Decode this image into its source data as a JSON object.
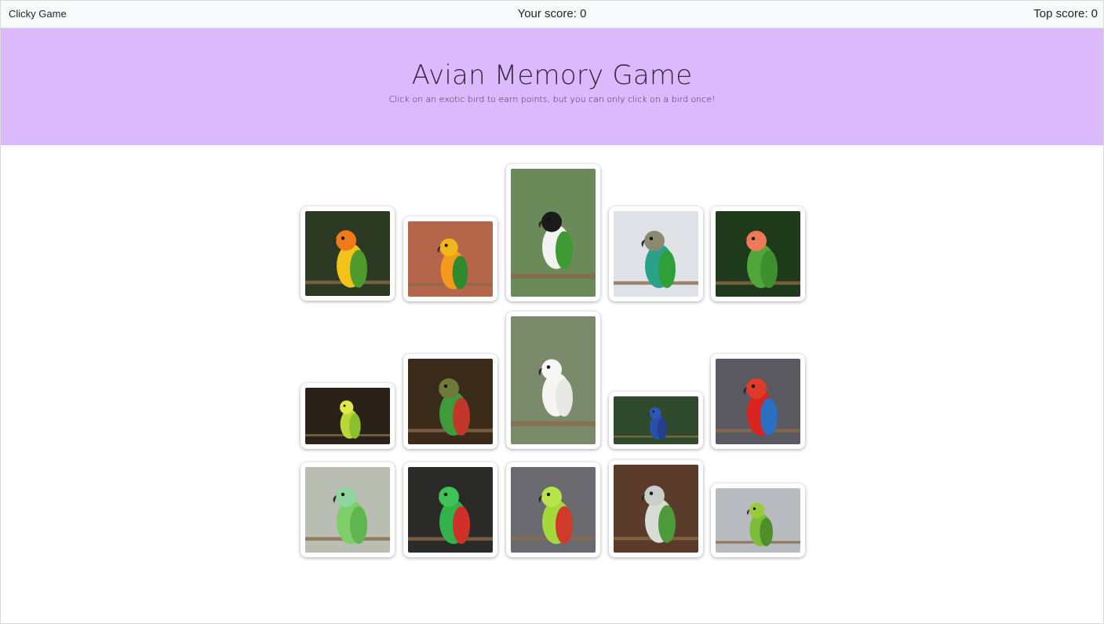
{
  "navbar": {
    "brand": "Clicky Game",
    "score_text": "Your score: 0",
    "top_score_text": "Top score: 0"
  },
  "header": {
    "title": "Avian Memory Game",
    "subtitle": "Click on an exotic bird to earn points, but you can only click on a bird once!"
  },
  "colors": {
    "header_background": "#dcb9fd",
    "navbar_background": "#f8f9fa"
  },
  "birds": [
    {
      "name": "sun-conure",
      "bg": "#2c3a24",
      "body": "#f2c21a",
      "head": "#f07a1a",
      "wing": "#4e9a2c"
    },
    {
      "name": "jenday-conure",
      "bg": "#b5654a",
      "body": "#f39a1d",
      "head": "#f2b51a",
      "wing": "#2f8a2e"
    },
    {
      "name": "black-headed-caique",
      "bg": "#6a8a5a",
      "body": "#f2f2f0",
      "head": "#1b1b1b",
      "wing": "#3f9a33"
    },
    {
      "name": "green-cheeked-conure",
      "bg": "#dfe3e8",
      "body": "#2aa28a",
      "head": "#8a8a70",
      "wing": "#2f9f3a"
    },
    {
      "name": "peach-faced-lovebird",
      "bg": "#1f3a1b",
      "body": "#4fa63a",
      "head": "#ef7a5a",
      "wing": "#3e8f2e"
    },
    {
      "name": "budgerigar",
      "bg": "#2a2118",
      "body": "#b8d83a",
      "head": "#e2ea4a",
      "wing": "#8bbf2e"
    },
    {
      "name": "crimson-bellied-conure",
      "bg": "#3a2a1a",
      "body": "#3f9a3a",
      "head": "#6d7a3a",
      "wing": "#c2372a"
    },
    {
      "name": "sulphur-crested-cockatoo",
      "bg": "#7a8a6a",
      "body": "#f5f5f2",
      "head": "#f7f7f5",
      "wing": "#e8e8e4"
    },
    {
      "name": "hyacinth-macaw",
      "bg": "#2f4a2c",
      "body": "#2a4fa8",
      "head": "#2f58b6",
      "wing": "#243f8f"
    },
    {
      "name": "scarlet-macaw",
      "bg": "#5a5860",
      "body": "#d8231f",
      "head": "#e23a2a",
      "wing": "#2a6fc2"
    },
    {
      "name": "ring-necked-parakeet",
      "bg": "#b9bdb2",
      "body": "#7ecf6a",
      "head": "#8fd6a0",
      "wing": "#5fb64e"
    },
    {
      "name": "eclectus-parrot",
      "bg": "#2a2a28",
      "body": "#32b24a",
      "head": "#3fc257",
      "wing": "#d0302a"
    },
    {
      "name": "alexandrine-parakeet",
      "bg": "#6a6a70",
      "body": "#a5d83a",
      "head": "#b8e64a",
      "wing": "#cf3a2a"
    },
    {
      "name": "quaker-parrot",
      "bg": "#5a3a28",
      "body": "#d8dcd6",
      "head": "#c9cfc8",
      "wing": "#4d9a3a"
    },
    {
      "name": "parrotlet",
      "bg": "#b8bcc0",
      "body": "#7dbd3a",
      "head": "#9acc3a",
      "wing": "#4f8f2a"
    }
  ]
}
